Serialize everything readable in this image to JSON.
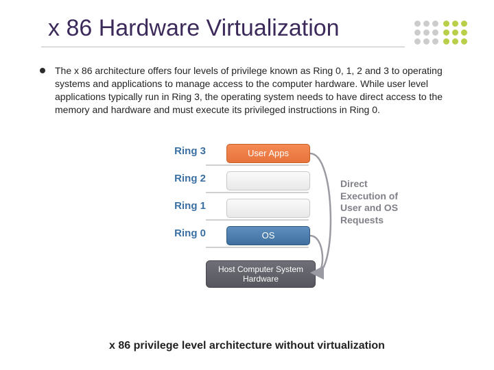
{
  "title": "x 86 Hardware Virtualization",
  "body": "The x 86 architecture offers four levels of privilege known as Ring 0, 1, 2 and 3 to operating systems and applications to manage access to the computer hardware. While user level applications typically run in Ring 3, the operating system needs to have direct access to the memory and hardware and must execute its privileged instructions in Ring 0.",
  "diagram": {
    "ring3": "Ring 3",
    "ring2": "Ring 2",
    "ring1": "Ring 1",
    "ring0": "Ring 0",
    "user_apps": "User Apps",
    "os": "OS",
    "host": "Host Computer System Hardware",
    "side": "Direct Execution of User and OS Requests"
  },
  "caption": "x 86 privilege level architecture without virtualization"
}
